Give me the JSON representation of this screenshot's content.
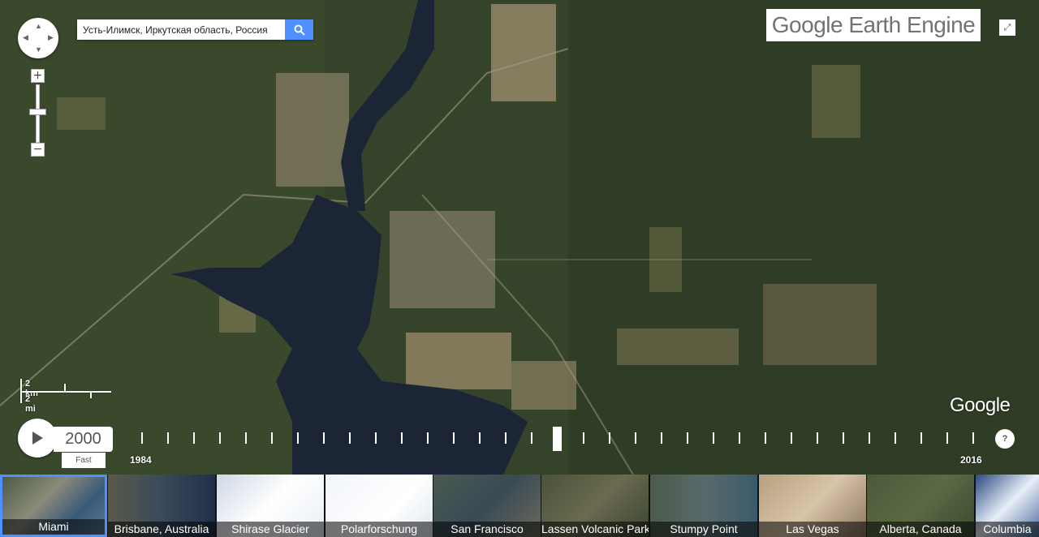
{
  "search": {
    "value": "Усть-Илимск, Иркутская область, Россия",
    "button_icon": "search-icon"
  },
  "brand": {
    "text": "Google Earth Engine"
  },
  "fullscreen": {
    "icon": "fullscreen-icon"
  },
  "zoom": {
    "in_label": "+",
    "out_label": "−"
  },
  "scale": {
    "km_label": "2 km",
    "mi_label": "2 mi"
  },
  "watermark": {
    "text": "Google"
  },
  "player": {
    "year": "2000",
    "speed": "Fast",
    "start_year": "1984",
    "end_year": "2016",
    "help": "?"
  },
  "thumbnails": [
    {
      "label": "Miami",
      "active": true
    },
    {
      "label": "Brisbane, Australia"
    },
    {
      "label": "Shirase Glacier"
    },
    {
      "label": "Polarforschung"
    },
    {
      "label": "San Francisco"
    },
    {
      "label": "Lassen Volcanic Park"
    },
    {
      "label": "Stumpy Point"
    },
    {
      "label": "Las Vegas"
    },
    {
      "label": "Alberta, Canada"
    },
    {
      "label": "Columbia"
    }
  ],
  "colors": {
    "accent": "#4d90fe",
    "forest": "#3a4a2a",
    "water": "#1b2536"
  }
}
